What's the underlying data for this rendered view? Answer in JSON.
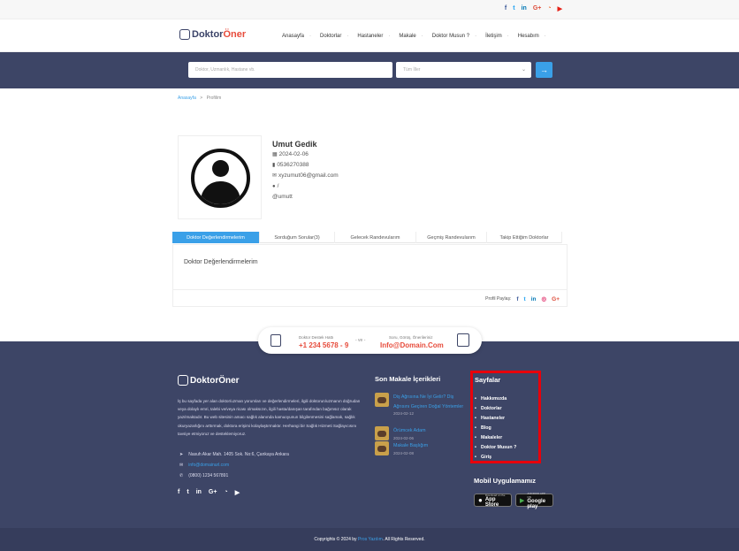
{
  "header": {
    "social": [
      "f",
      "t",
      "in",
      "G+",
      "rss",
      "yt"
    ],
    "logo": {
      "part1": "Doktor",
      "part2": "Öner"
    },
    "nav": [
      "Anasayfa",
      "Doktorlar",
      "Hastaneler",
      "Makale",
      "Doktor Musun ?",
      "İletişim",
      "Hesabım"
    ],
    "search": {
      "placeholder": "Doktor, Uzmanlık, Hastane vb.",
      "select_value": "Tüm İller",
      "button_icon": "arrow-right-icon"
    }
  },
  "breadcrumb": {
    "home": "Anasayfa",
    "sep": ">",
    "current": "Profilim"
  },
  "profile": {
    "name": "Umut Gedik",
    "date": "2024-02-06",
    "phone": "0536270388",
    "email": "xyzumut06@gmail.com",
    "location": "/",
    "username": "@umutt"
  },
  "tabs": [
    "Doktor Değerlendirmelerim",
    "Sorduğum Sorular(3)",
    "Gelecek Randevularım",
    "Geçmiş Randevularım",
    "Takip Ettiğim Doktorlar"
  ],
  "panel": {
    "title": "Doktor Değerlendirmelerim",
    "share_label": "Profil Paylaş:"
  },
  "support": {
    "left_label": "Doktor Destek Hattı",
    "left_value": "+1 234 5678 - 9",
    "middle": "- ve -",
    "right_label": "Soru, Görüş, Önerileriniz",
    "right_value": "Info@Domain.Com"
  },
  "footer": {
    "logo": {
      "part1": "Doktor",
      "part2": "Öner"
    },
    "description": "İş bu sayfada yer alan doktor/uzman yorumları ve değerlendirmeleri, ilgili doktorun/uzmanın doğrudan veya dolaylı emri, talebi ve/veya ricası olmaksızın, ilgili hasta/danışan tarafından bağımsız olarak yazılmaktadır. Bu web sitesinin amacı sağlık alanında kamuoyunun bilgilenmesini sağlamak, sağlık okuryazarlığını arttırmak, doktora erişimi kolaylaştırmaktır. Herhangi bir Sağlık Hizmeti Sağlayıcısını tavsiye etmiyoruz ve desteklemiyoruz.",
    "address": "Nasuh Akar Mah. 1405 Sok. No:6, Çankaya Ankara",
    "email": "info@domainurl.com",
    "phone": "(0800) 1234 567891",
    "articles_title": "Son Makale İçerikleri",
    "articles": [
      {
        "title": "Diş Ağrısına Ne İyi Gelir? Diş Ağrısını Geçiren Doğal Yöntemler",
        "date": "2024-02-12"
      },
      {
        "title": "Örümcek Adam",
        "date": "2024-02-06"
      },
      {
        "title": "Makale Başlığım",
        "date": "2024-02-08"
      }
    ],
    "pages_title": "Sayfalar",
    "pages": [
      "Hakkımızda",
      "Doktorlar",
      "Hastaneler",
      "Blog",
      "Makaleler",
      "Doktor Musun ?",
      "Giriş"
    ],
    "mobile_title": "Mobil Uygulamamız",
    "appstore": {
      "small": "Download on the",
      "big": "App Store"
    },
    "googleplay": {
      "small": "ANDROID APP ON",
      "big": "Google play"
    },
    "copyright_pre": "Copyrights © 2024 by",
    "copyright_brand": "Pros Yazılım",
    "copyright_post": ". All Rights Reserved."
  },
  "colors": {
    "primary": "#3aa0e8",
    "dark": "#3d4566",
    "accent": "#e74c3c",
    "highlight": "#e8000b"
  }
}
